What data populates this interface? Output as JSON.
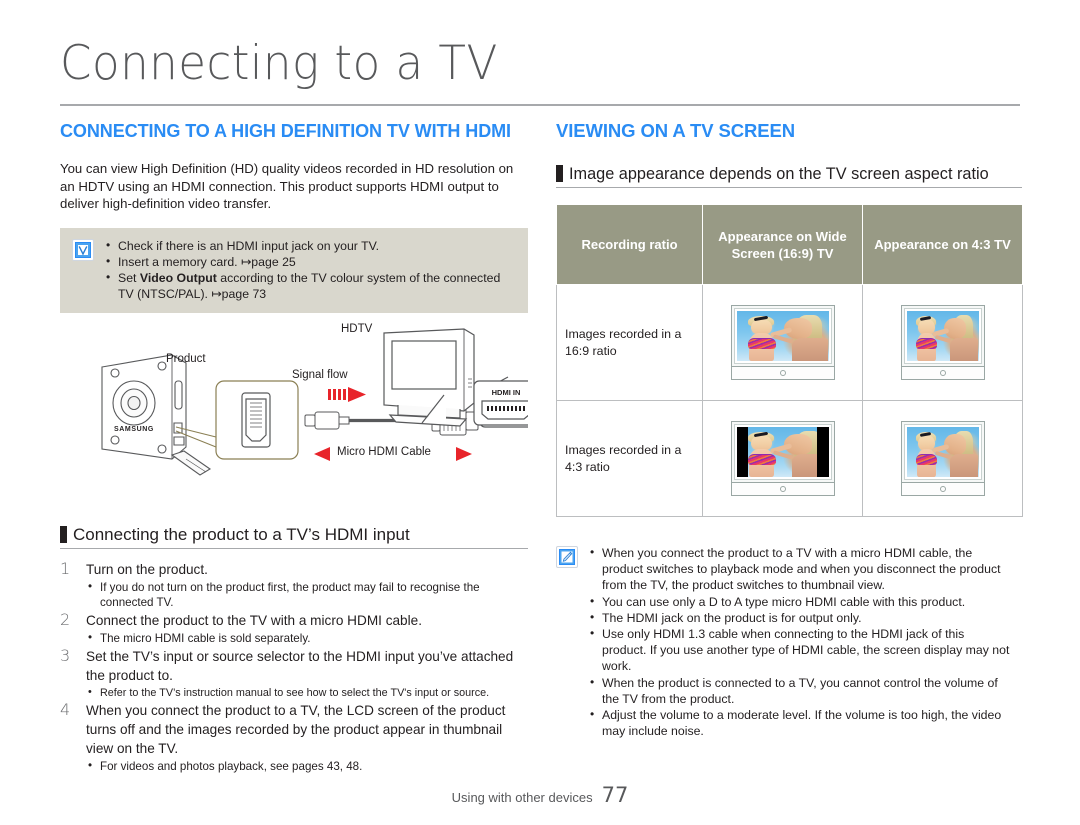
{
  "page": {
    "title": "Connecting to a TV",
    "footer_text": "Using with other devices",
    "footer_page_number": "77",
    "accent_blue": "#2a8cf4",
    "tip_bg": "#d9d7cd",
    "table_header_bg": "#989a85"
  },
  "left": {
    "section_heading": "CONNECTING TO A HIGH DEFINITION TV WITH HDMI",
    "intro_paragraph": "You can view High Definition (HD) quality videos recorded in HD resolution on an HDTV using an HDMI connection. This product supports HDMI output to deliver high-definition video transfer.",
    "tipbox": {
      "icon": "checkmark-icon",
      "items": [
        {
          "text": "Check if there is an HDMI input jack on your TV."
        },
        {
          "text": "Insert a memory card. ↦page 25"
        },
        {
          "pre": "Set ",
          "bold": "Video Output",
          "post": " according to the TV colour system of the connected TV (NTSC/PAL). ↦page 73"
        }
      ]
    },
    "diagram": {
      "label_product": "Product",
      "label_hdtv": "HDTV",
      "label_signal_flow": "Signal flow",
      "label_micro_hdmi_cable": "Micro HDMI Cable",
      "label_hdmi_in": "HDMI IN"
    },
    "sub_heading": "Connecting the product to a TV’s HDMI input",
    "steps": [
      {
        "num": "1",
        "text": "Turn on the product.",
        "subs": [
          "If you do not turn on the product first, the product may fail to recognise the connected TV."
        ]
      },
      {
        "num": "2",
        "text": "Connect the product to the TV with a micro HDMI cable.",
        "subs": [
          "The micro HDMI cable is sold separately."
        ]
      },
      {
        "num": "3",
        "text": "Set the TV’s input or source selector to the HDMI input you’ve attached the product to.",
        "subs": [
          "Refer to the TV’s instruction manual to see how to select the TV's input or source."
        ]
      },
      {
        "num": "4",
        "text": "When you connect the product to a TV, the LCD screen of the product turns off and the images recorded by the product appear in thumbnail view on the TV.",
        "subs": [
          "For videos and photos playback, see pages 43, 48."
        ]
      }
    ]
  },
  "right": {
    "section_heading": "VIEWING ON A TV SCREEN",
    "sub_heading": "Image appearance depends on the TV screen aspect ratio",
    "table": {
      "headers": [
        "Recording ratio",
        "Appearance on Wide Screen (16:9) TV",
        "Appearance on 4:3 TV"
      ],
      "rows": [
        {
          "label": "Images recorded in a 16:9 ratio",
          "wide": "fills-16x9",
          "four_three": "letterboxed-4x3"
        },
        {
          "label": "Images recorded in a 4:3 ratio",
          "wide": "pillarboxed-16x9",
          "four_three": "fills-4x3"
        }
      ]
    },
    "tipbox": {
      "icon": "note-pencil-icon",
      "items": [
        "When you connect the product to a TV with a micro HDMI cable, the product switches to playback mode and when you disconnect the product from the TV, the product switches to thumbnail view.",
        "You can use only a D to A type micro HDMI cable with this product.",
        "The HDMI jack on the product is for output only.",
        "Use only HDMI 1.3 cable when connecting to the HDMI jack of this product. If you use another type of HDMI cable, the screen display may not work.",
        "When the product is connected to a TV, you cannot control the volume of the TV from the product.",
        "Adjust the volume to a moderate level. If the volume is too high, the video may include noise."
      ]
    }
  }
}
